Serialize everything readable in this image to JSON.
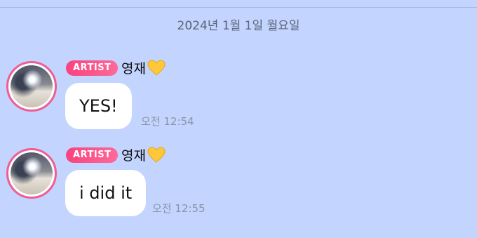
{
  "date_divider": "2024년 1월 1일 월요일",
  "colors": {
    "background": "#c3d4ff",
    "badge": "#f9427e",
    "avatar_ring": "#ef5d95",
    "bubble": "#ffffff",
    "timestamp": "#8a93a8"
  },
  "messages": [
    {
      "badge": "ARTIST",
      "sender": "영재",
      "emoji_icon": "yellow-heart-icon",
      "text": "YES!",
      "time": "오전 12:54"
    },
    {
      "badge": "ARTIST",
      "sender": "영재",
      "emoji_icon": "yellow-heart-icon",
      "text": "i did it",
      "time": "오전 12:55"
    }
  ]
}
